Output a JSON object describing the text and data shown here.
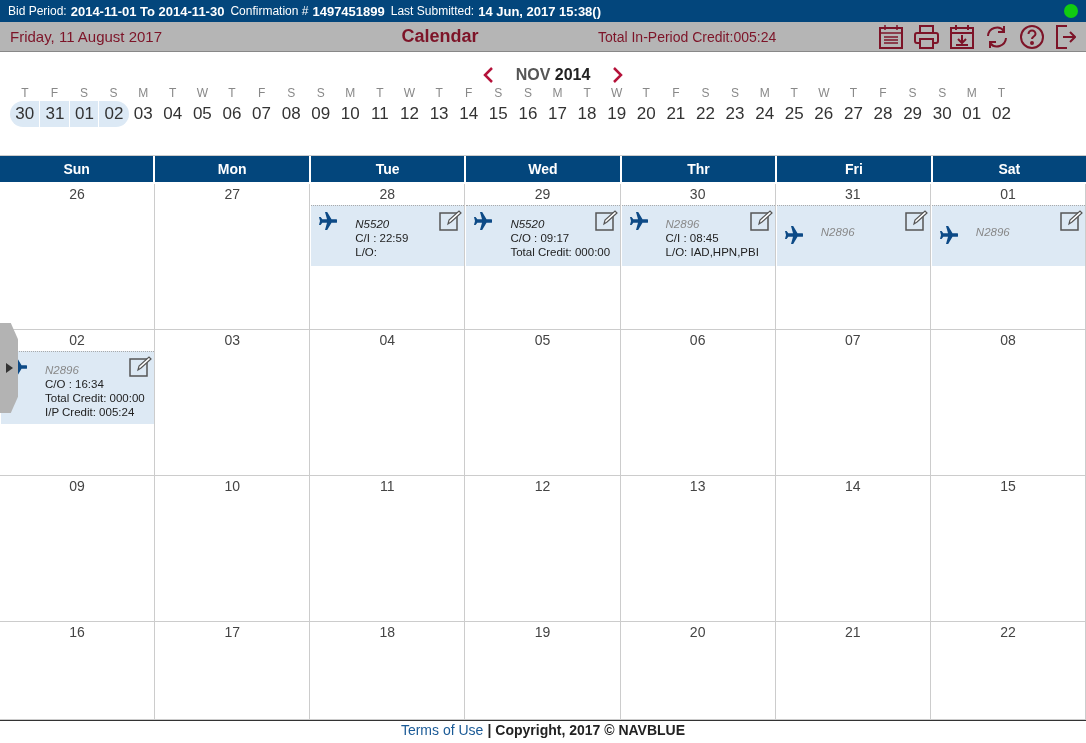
{
  "top_bar": {
    "items": [
      {
        "label": "Bid Period:",
        "value": "2014-11-01 To 2014-11-30"
      },
      {
        "label": "Confirmation #",
        "value": "1497451899"
      },
      {
        "label": "Last Submitted:",
        "value": "14 Jun, 2017 15:38()"
      }
    ]
  },
  "header": {
    "date": "Friday, 11 August 2017",
    "title": "Calendar",
    "credit": "Total In-Period Credit:005:24"
  },
  "month_nav": {
    "month": "NOV",
    "year": "2014"
  },
  "day_strip": [
    {
      "weekday": "T",
      "day": "30",
      "selected": true
    },
    {
      "weekday": "F",
      "day": "31",
      "selected": true
    },
    {
      "weekday": "S",
      "day": "01",
      "selected": true
    },
    {
      "weekday": "S",
      "day": "02",
      "selected": true
    },
    {
      "weekday": "M",
      "day": "03",
      "selected": false
    },
    {
      "weekday": "T",
      "day": "04",
      "selected": false
    },
    {
      "weekday": "W",
      "day": "05",
      "selected": false
    },
    {
      "weekday": "T",
      "day": "06",
      "selected": false
    },
    {
      "weekday": "F",
      "day": "07",
      "selected": false
    },
    {
      "weekday": "S",
      "day": "08",
      "selected": false
    },
    {
      "weekday": "S",
      "day": "09",
      "selected": false
    },
    {
      "weekday": "M",
      "day": "10",
      "selected": false
    },
    {
      "weekday": "T",
      "day": "11",
      "selected": false
    },
    {
      "weekday": "W",
      "day": "12",
      "selected": false
    },
    {
      "weekday": "T",
      "day": "13",
      "selected": false
    },
    {
      "weekday": "F",
      "day": "14",
      "selected": false
    },
    {
      "weekday": "S",
      "day": "15",
      "selected": false
    },
    {
      "weekday": "S",
      "day": "16",
      "selected": false
    },
    {
      "weekday": "M",
      "day": "17",
      "selected": false
    },
    {
      "weekday": "T",
      "day": "18",
      "selected": false
    },
    {
      "weekday": "W",
      "day": "19",
      "selected": false
    },
    {
      "weekday": "T",
      "day": "20",
      "selected": false
    },
    {
      "weekday": "F",
      "day": "21",
      "selected": false
    },
    {
      "weekday": "S",
      "day": "22",
      "selected": false
    },
    {
      "weekday": "S",
      "day": "23",
      "selected": false
    },
    {
      "weekday": "M",
      "day": "24",
      "selected": false
    },
    {
      "weekday": "T",
      "day": "25",
      "selected": false
    },
    {
      "weekday": "W",
      "day": "26",
      "selected": false
    },
    {
      "weekday": "T",
      "day": "27",
      "selected": false
    },
    {
      "weekday": "F",
      "day": "28",
      "selected": false
    },
    {
      "weekday": "S",
      "day": "29",
      "selected": false
    },
    {
      "weekday": "S",
      "day": "30",
      "selected": false
    },
    {
      "weekday": "M",
      "day": "01",
      "selected": false
    },
    {
      "weekday": "T",
      "day": "02",
      "selected": false
    }
  ],
  "calendar": {
    "columns": [
      "Sun",
      "Mon",
      "Tue",
      "Wed",
      "Thr",
      "Fri",
      "Sat"
    ],
    "weeks": [
      [
        {
          "day": "26"
        },
        {
          "day": "27"
        },
        {
          "day": "28",
          "event": {
            "trip": "N5520",
            "muted": false,
            "lines": [
              "C/I : 22:59",
              "L/O:"
            ]
          }
        },
        {
          "day": "29",
          "event": {
            "trip": "N5520",
            "muted": false,
            "lines": [
              "C/O : 09:17",
              "Total Credit: 000:00"
            ]
          }
        },
        {
          "day": "30",
          "event": {
            "trip": "N2896",
            "muted": true,
            "lines": [
              "C/I : 08:45",
              "L/O: IAD,HPN,PBI"
            ]
          }
        },
        {
          "day": "31",
          "event": {
            "trip": "N2896",
            "muted": true
          }
        },
        {
          "day": "01",
          "event": {
            "trip": "N2896",
            "muted": true
          }
        }
      ],
      [
        {
          "day": "02",
          "event": {
            "trip": "N2896",
            "muted": true,
            "lines": [
              "C/O : 16:34",
              "Total Credit: 000:00",
              "I/P Credit: 005:24"
            ]
          }
        },
        {
          "day": "03"
        },
        {
          "day": "04"
        },
        {
          "day": "05"
        },
        {
          "day": "06"
        },
        {
          "day": "07"
        },
        {
          "day": "08"
        }
      ],
      [
        {
          "day": "09"
        },
        {
          "day": "10"
        },
        {
          "day": "11"
        },
        {
          "day": "12"
        },
        {
          "day": "13"
        },
        {
          "day": "14"
        },
        {
          "day": "15"
        }
      ],
      [
        {
          "day": "16"
        },
        {
          "day": "17"
        },
        {
          "day": "18"
        },
        {
          "day": "19"
        },
        {
          "day": "20"
        },
        {
          "day": "21"
        },
        {
          "day": "22"
        }
      ]
    ]
  },
  "footer": {
    "link": "Terms of Use",
    "separator": "|",
    "text": "Copyright, 2017 © NAVBLUE"
  }
}
